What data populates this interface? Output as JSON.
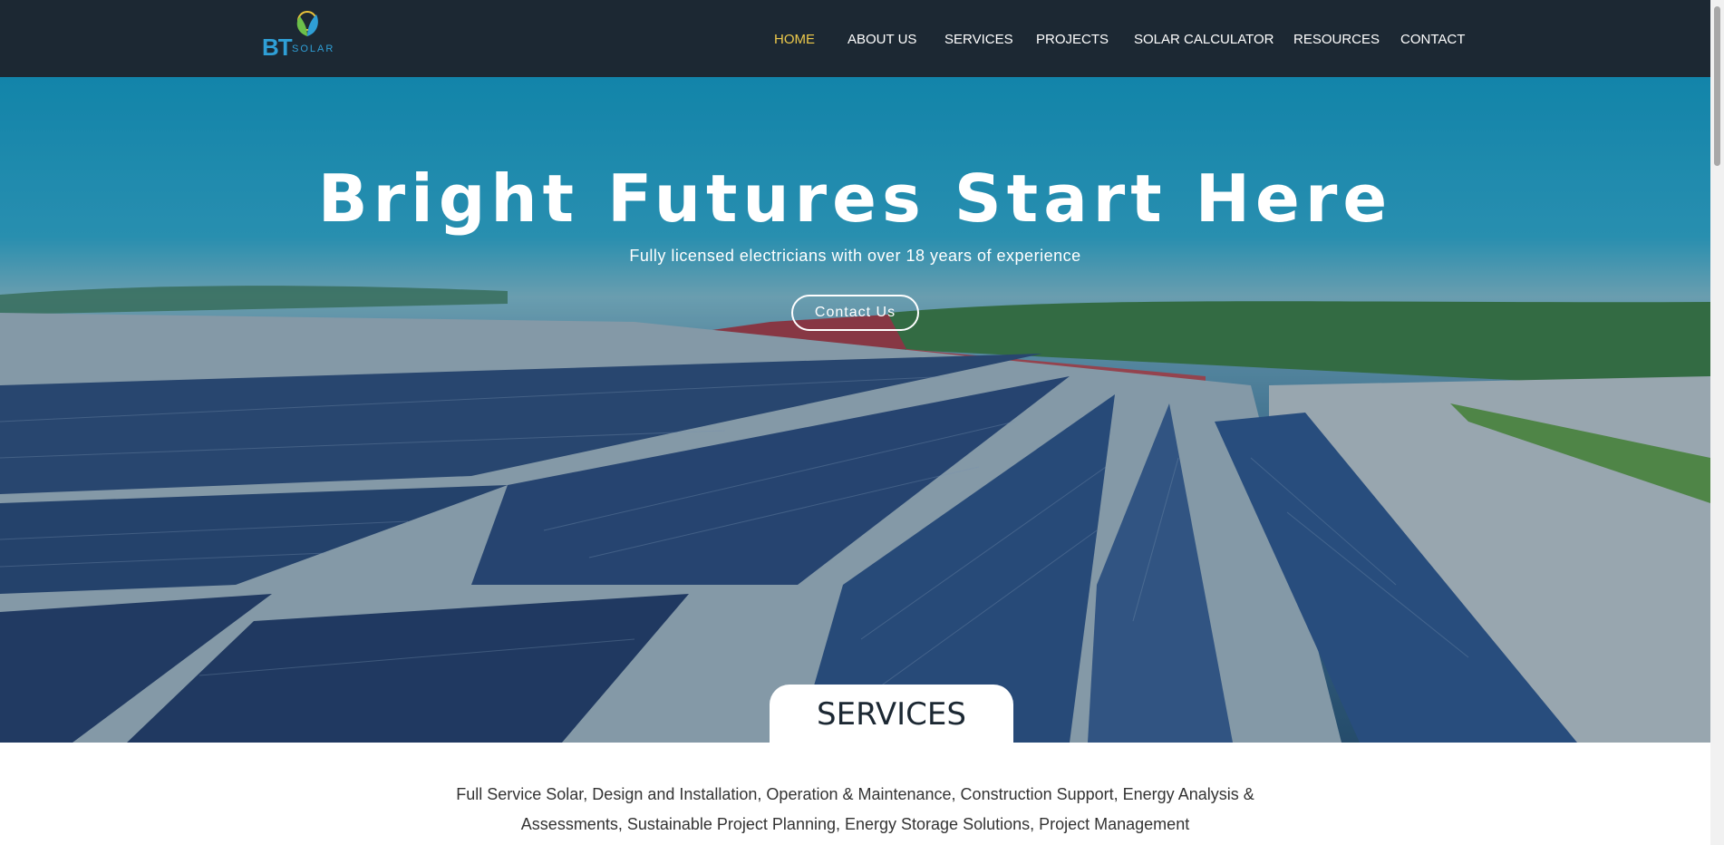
{
  "brand": {
    "logo_text": "BT",
    "logo_sub": "SOLAR",
    "accent_color": "#ecc94b",
    "header_color": "#1c2833"
  },
  "nav": {
    "items": [
      {
        "label": "HOME",
        "active": true
      },
      {
        "label": "ABOUT US",
        "active": false
      },
      {
        "label": "SERVICES",
        "active": false
      },
      {
        "label": "PROJECTS",
        "active": false
      },
      {
        "label": "SOLAR CALCULATOR",
        "active": false
      },
      {
        "label": "RESOURCES",
        "active": false
      },
      {
        "label": "CONTACT",
        "active": false
      }
    ]
  },
  "hero": {
    "title": "Bright Futures Start Here",
    "subtitle": "Fully licensed electricians with over 18 years of experience",
    "cta_label": "Contact Us",
    "image_icon": "rooftop-solar-panels-image"
  },
  "services": {
    "heading": "SERVICES",
    "description": "Full Service Solar, Design and Installation, Operation & Maintenance, Construction Support, Energy Analysis & Assessments, Sustainable Project Planning, Energy Storage Solutions, Project Management"
  }
}
